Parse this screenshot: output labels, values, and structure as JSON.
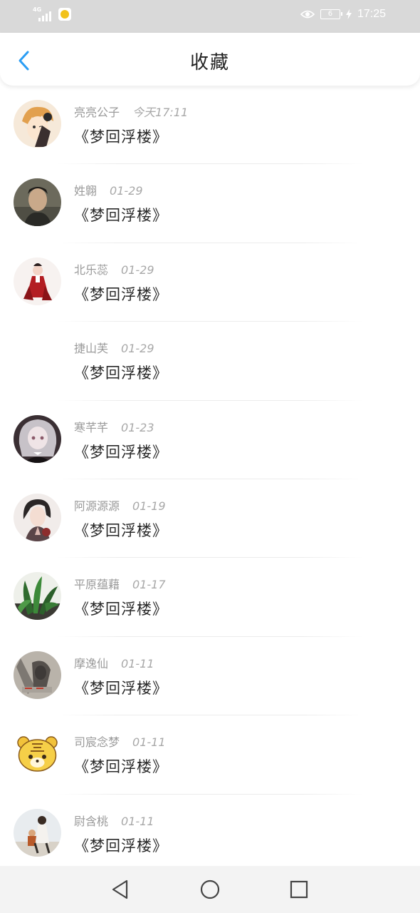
{
  "status_bar": {
    "network": "4G",
    "battery": "6",
    "time": "17:25",
    "icons": [
      "signal-icon",
      "app-notification-icon",
      "eye-comfort-icon",
      "battery-icon",
      "charging-icon"
    ]
  },
  "header": {
    "title": "收藏",
    "back_icon": "chevron-left-icon",
    "accent": "#2a9df4"
  },
  "favorites": [
    {
      "user": "亮亮公子",
      "date": "今天17:11",
      "title": "《梦回浮楼》",
      "avatar": "anime-boy"
    },
    {
      "user": "姓翺",
      "date": "01-29",
      "title": "《梦回浮楼》",
      "avatar": "man-photo"
    },
    {
      "user": "北乐蕊",
      "date": "01-29",
      "title": "《梦回浮楼》",
      "avatar": "girl-red-dress"
    },
    {
      "user": "捷山芙",
      "date": "01-29",
      "title": "《梦回浮楼》",
      "avatar": "none"
    },
    {
      "user": "寒芊芊",
      "date": "01-23",
      "title": "《梦回浮楼》",
      "avatar": "anime-girl-silver"
    },
    {
      "user": "阿源源源",
      "date": "01-19",
      "title": "《梦回浮楼》",
      "avatar": "anime-man"
    },
    {
      "user": "平原蕴藉",
      "date": "01-17",
      "title": "《梦回浮楼》",
      "avatar": "plant"
    },
    {
      "user": "摩逸仙",
      "date": "01-11",
      "title": "《梦回浮楼》",
      "avatar": "gray-figure"
    },
    {
      "user": "司宸念梦",
      "date": "01-11",
      "title": "《梦回浮楼》",
      "avatar": "tiger-cartoon"
    },
    {
      "user": "尉含桃",
      "date": "01-11",
      "title": "《梦回浮楼》",
      "avatar": "couple-photo"
    }
  ],
  "nav_bar": {
    "back": "triangle-back-icon",
    "home": "circle-home-icon",
    "recents": "square-recents-icon"
  }
}
